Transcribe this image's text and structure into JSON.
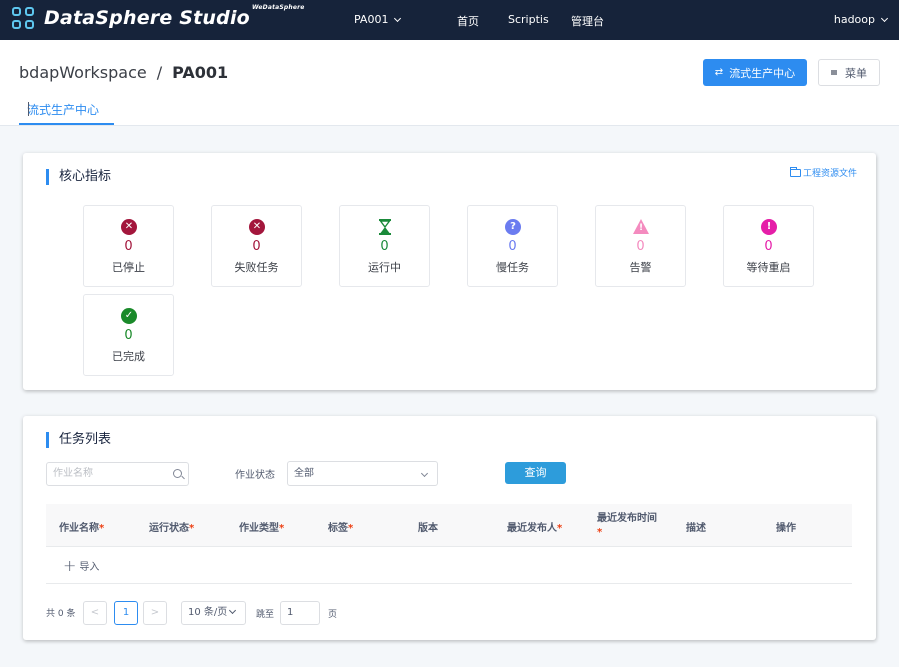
{
  "colors": {
    "nav_bg": "#16233a",
    "accent": "#2d8cf0",
    "query_btn": "#2d9cdb"
  },
  "nav": {
    "brand": "DataSphere Studio",
    "brand_sup": "WeDataSphere",
    "project": "PA001",
    "items": [
      "首页",
      "Scriptis",
      "管理台"
    ],
    "user": "hadoop"
  },
  "header": {
    "workspace": "bdapWorkspace",
    "separator": "/",
    "project": "PA001",
    "primary_button": "流式生产中心",
    "menu_button": "菜单",
    "tab": "流式生产中心"
  },
  "metrics": {
    "title": "核心指标",
    "resource_link": "工程资源文件",
    "items": [
      {
        "label": "已停止",
        "value": "0",
        "icon": "stopped-x-icon",
        "color": "#a3163c"
      },
      {
        "label": "失败任务",
        "value": "0",
        "icon": "failed-x-icon",
        "color": "#a3163c"
      },
      {
        "label": "运行中",
        "value": "0",
        "icon": "hourglass-icon",
        "color": "#1a8a3a"
      },
      {
        "label": "慢任务",
        "value": "0",
        "icon": "question-icon",
        "color": "#6b7cf0"
      },
      {
        "label": "告警",
        "value": "0",
        "icon": "warning-icon",
        "color": "#f48bbf"
      },
      {
        "label": "等待重启",
        "value": "0",
        "icon": "exclamation-icon",
        "color": "#e51ea8"
      },
      {
        "label": "已完成",
        "value": "0",
        "icon": "check-icon",
        "color": "#1a8a2a"
      }
    ]
  },
  "tasks": {
    "title": "任务列表",
    "search_placeholder": "作业名称",
    "status_label": "作业状态",
    "status_value": "全部",
    "query_button": "查询",
    "columns": [
      {
        "label": "作业名称",
        "required": "*"
      },
      {
        "label": "运行状态",
        "required": "*"
      },
      {
        "label": "作业类型",
        "required": "*"
      },
      {
        "label": "标签",
        "required": "*"
      },
      {
        "label": "版本",
        "required": ""
      },
      {
        "label": "最近发布人",
        "required": "*"
      },
      {
        "label": "最近发布时间",
        "required": "*"
      },
      {
        "label": "描述",
        "required": ""
      },
      {
        "label": "操作",
        "required": ""
      }
    ],
    "import_label": "导入",
    "pagination": {
      "total": "共 0 条",
      "prev": "<",
      "current_page": "1",
      "next": ">",
      "page_size": "10 条/页",
      "jump_label": "跳至",
      "jump_value": "1",
      "page_suffix": "页"
    }
  }
}
